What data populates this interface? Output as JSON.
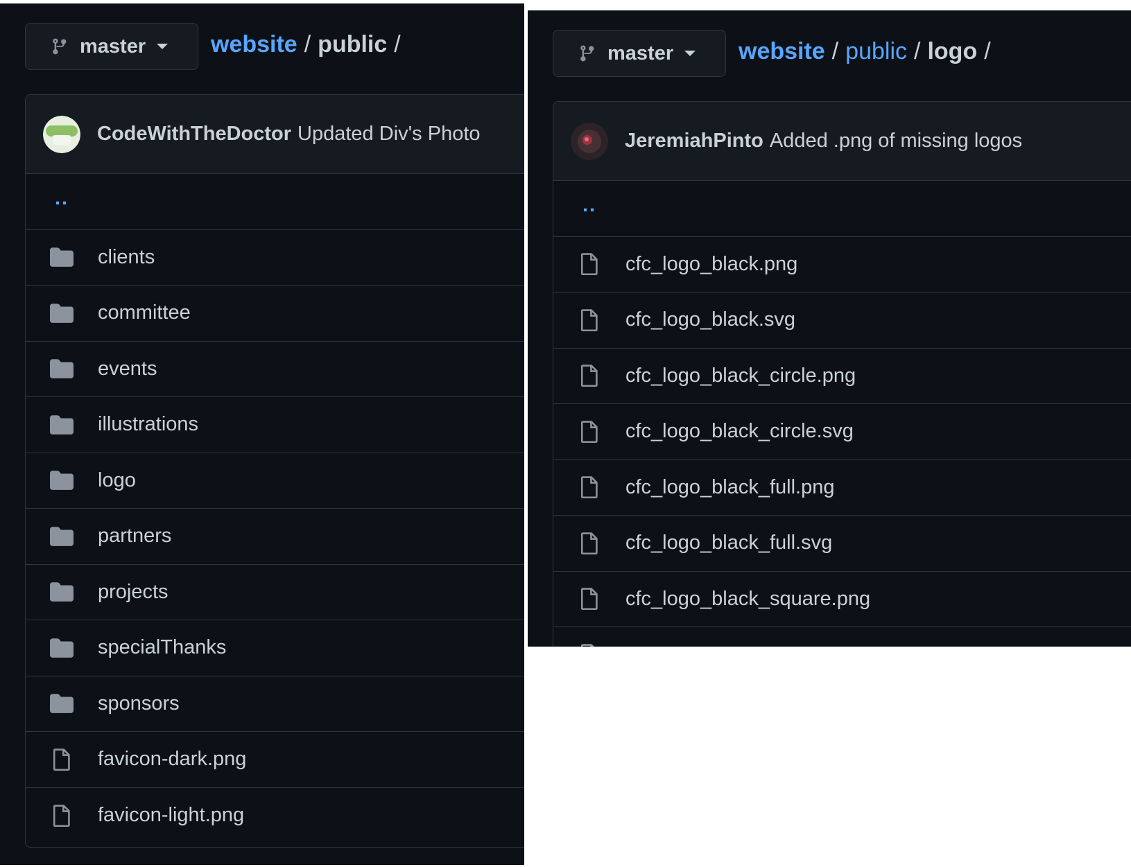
{
  "left": {
    "branch": "master",
    "breadcrumb": {
      "root": "website",
      "current": "public",
      "sep": "/"
    },
    "commit": {
      "author": "CodeWithTheDoctor",
      "message": "Updated Div's Photo"
    },
    "parent": "..",
    "items": [
      {
        "type": "folder",
        "name": "clients"
      },
      {
        "type": "folder",
        "name": "committee"
      },
      {
        "type": "folder",
        "name": "events"
      },
      {
        "type": "folder",
        "name": "illustrations"
      },
      {
        "type": "folder",
        "name": "logo"
      },
      {
        "type": "folder",
        "name": "partners"
      },
      {
        "type": "folder",
        "name": "projects"
      },
      {
        "type": "folder",
        "name": "specialThanks"
      },
      {
        "type": "folder",
        "name": "sponsors"
      },
      {
        "type": "file",
        "name": "favicon-dark.png"
      },
      {
        "type": "file",
        "name": "favicon-light.png"
      }
    ]
  },
  "right": {
    "branch": "master",
    "breadcrumb": {
      "root": "website",
      "middle": "public",
      "current": "logo",
      "sep": "/"
    },
    "commit": {
      "author": "JeremiahPinto",
      "message": "Added .png of missing logos"
    },
    "parent": "..",
    "items": [
      {
        "type": "file",
        "name": "cfc_logo_black.png"
      },
      {
        "type": "file",
        "name": "cfc_logo_black.svg"
      },
      {
        "type": "file",
        "name": "cfc_logo_black_circle.png"
      },
      {
        "type": "file",
        "name": "cfc_logo_black_circle.svg"
      },
      {
        "type": "file",
        "name": "cfc_logo_black_full.png"
      },
      {
        "type": "file",
        "name": "cfc_logo_black_full.svg"
      },
      {
        "type": "file",
        "name": "cfc_logo_black_square.png"
      },
      {
        "type": "file",
        "name": ""
      }
    ]
  },
  "colors": {
    "background": "#0d1117",
    "header": "#161b22",
    "border": "#30363d",
    "link": "#58a6ff",
    "text": "#c9d1d9",
    "icon": "#8b949e"
  },
  "icons": {
    "branch": "git-branch-icon",
    "folder": "folder-icon",
    "file": "file-icon"
  }
}
